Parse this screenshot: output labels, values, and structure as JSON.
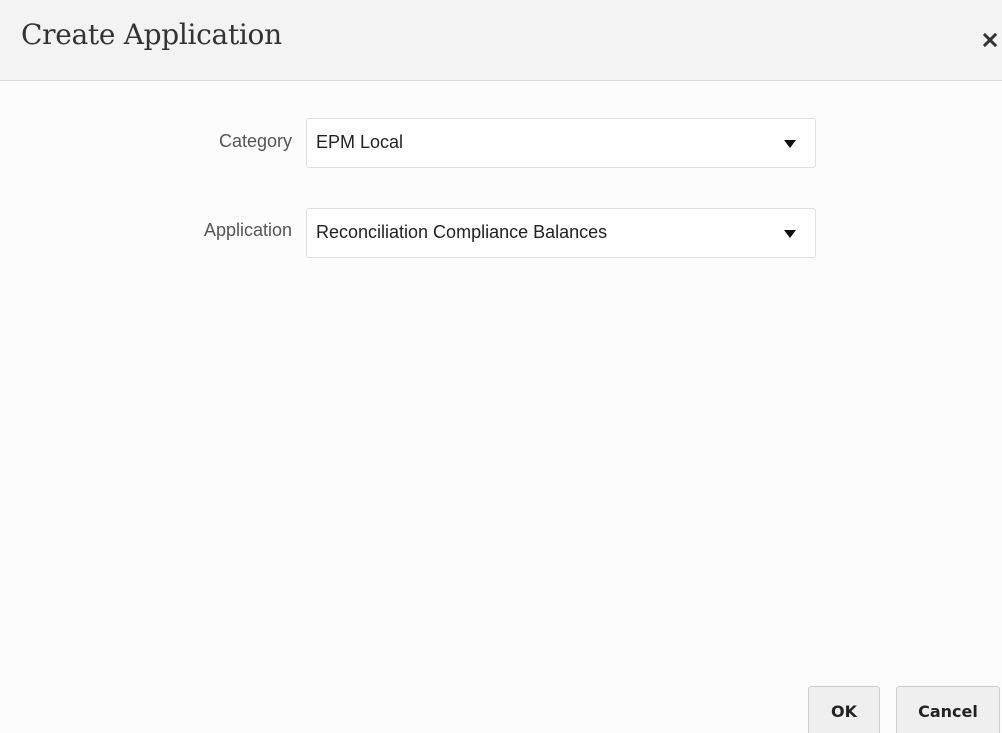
{
  "dialog": {
    "title": "Create Application",
    "close_icon": "close-icon"
  },
  "form": {
    "category": {
      "label": "Category",
      "value": "EPM Local"
    },
    "application": {
      "label": "Application",
      "value": "Reconciliation Compliance Balances"
    }
  },
  "footer": {
    "ok_label": "OK",
    "cancel_label": "Cancel"
  },
  "colors": {
    "header_bg": "#f3f3f3",
    "page_bg": "#fcfcfc",
    "button_bg": "#efefef"
  }
}
